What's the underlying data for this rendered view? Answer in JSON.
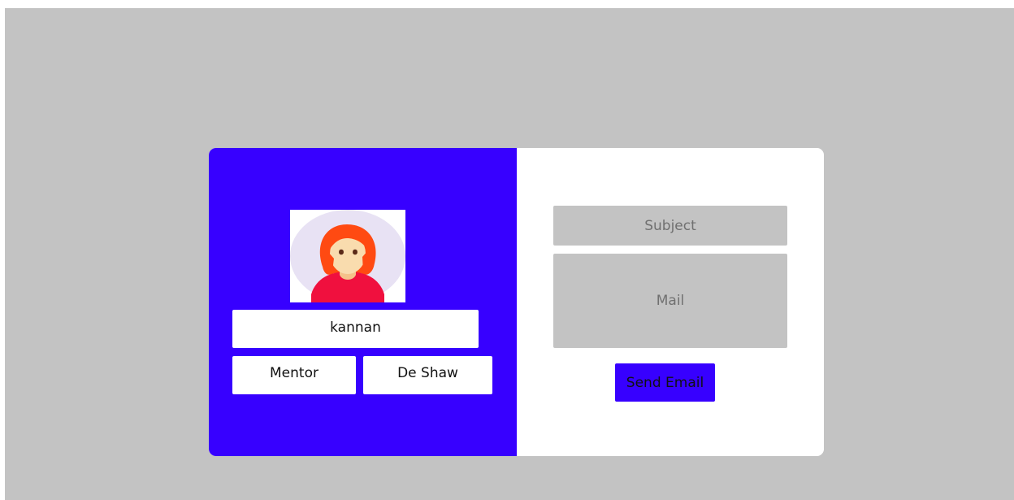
{
  "profile": {
    "name": "kannan",
    "role": "Mentor",
    "company": "De Shaw",
    "avatar_icon": "woman-avatar-icon"
  },
  "email_form": {
    "subject_placeholder": "Subject",
    "mail_placeholder": "Mail",
    "send_label": "Send Email"
  },
  "colors": {
    "page_background": "#c3c3c3",
    "accent": "#3700ff",
    "field_background": "#c3c3c3",
    "card_background": "#ffffff"
  }
}
